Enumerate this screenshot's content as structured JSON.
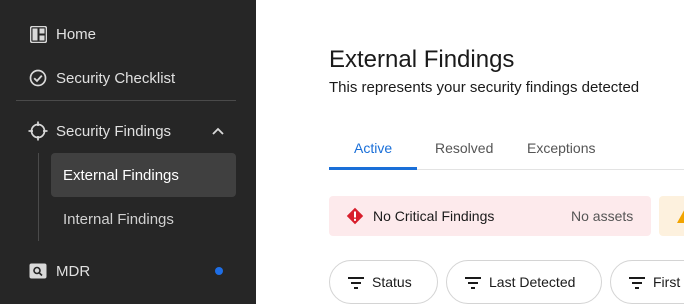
{
  "sidebar": {
    "items": [
      {
        "label": "Home",
        "icon": "dashboard-icon"
      },
      {
        "label": "Security Checklist",
        "icon": "check-circle-icon"
      },
      {
        "label": "Security Findings",
        "icon": "crosshair-icon",
        "expanded": true,
        "children": [
          {
            "label": "External Findings",
            "active": true
          },
          {
            "label": "Internal Findings"
          }
        ]
      },
      {
        "label": "MDR",
        "icon": "search-box-icon",
        "notification_dot": true
      }
    ],
    "accent_color": "#1e6ee6"
  },
  "main": {
    "title": "External Findings",
    "subtitle": "This represents your security findings detected",
    "tabs": [
      {
        "label": "Active",
        "active": true
      },
      {
        "label": "Resolved"
      },
      {
        "label": "Exceptions"
      }
    ],
    "alerts": [
      {
        "text": "No Critical Findings",
        "assets": "No assets",
        "severity": "critical",
        "bg": "#fdeaec",
        "icon": "critical-diamond-icon"
      },
      {
        "severity": "warning",
        "bg": "#fdf1de",
        "icon": "warning-triangle-icon"
      }
    ],
    "filters": [
      {
        "label": "Status"
      },
      {
        "label": "Last Detected"
      },
      {
        "label": "First"
      }
    ],
    "tab_accent": "#1a6fd8"
  }
}
